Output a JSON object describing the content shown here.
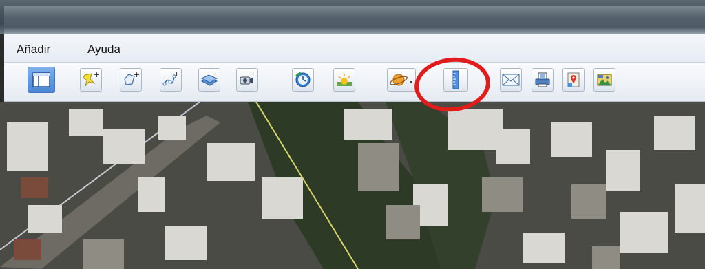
{
  "menubar": {
    "items": [
      {
        "label": "Añadir"
      },
      {
        "label": "Ayuda"
      }
    ]
  },
  "toolbar": {
    "buttons": [
      {
        "name": "sidebar-toggle",
        "icon": "sidebar-icon"
      },
      {
        "name": "add-placemark",
        "icon": "pushpin-plus-icon"
      },
      {
        "name": "add-polygon",
        "icon": "polygon-plus-icon"
      },
      {
        "name": "add-path",
        "icon": "path-plus-icon"
      },
      {
        "name": "add-image-overlay",
        "icon": "overlay-plus-icon"
      },
      {
        "name": "record-tour",
        "icon": "camera-plus-icon"
      },
      {
        "name": "historical-imagery",
        "icon": "clock-icon"
      },
      {
        "name": "sunlight",
        "icon": "sun-icon"
      },
      {
        "name": "switch-planet",
        "icon": "planet-icon"
      },
      {
        "name": "ruler",
        "icon": "ruler-icon"
      },
      {
        "name": "email",
        "icon": "envelope-icon"
      },
      {
        "name": "print",
        "icon": "printer-icon"
      },
      {
        "name": "view-in-maps",
        "icon": "maps-icon"
      },
      {
        "name": "save-image",
        "icon": "image-icon"
      }
    ]
  },
  "colors": {
    "highlight": "#e01c1c",
    "path_line": "#d8d66a",
    "sidebar_button": "#4a86d4"
  }
}
